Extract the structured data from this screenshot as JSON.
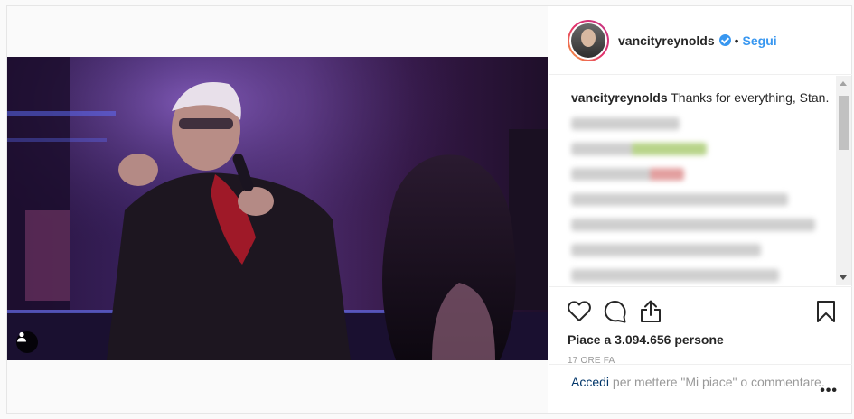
{
  "post": {
    "username": "vancityreynolds",
    "verified": true,
    "separator": "•",
    "follow_label": "Segui",
    "caption_user": "vancityreynolds",
    "caption_text": "Thanks for everything, Stan.",
    "likes": "Piace a 3.094.656 persone",
    "time": "17 ORE FA",
    "login_label": "Accedi",
    "login_suffix": "per mettere \"Mi piace\" o commentare.",
    "more_label": "•••"
  },
  "icons": {
    "like": "heart-icon",
    "comment": "comment-icon",
    "share": "share-icon",
    "save": "bookmark-icon",
    "tag": "user-tag-icon"
  },
  "colors": {
    "link": "#3897f0",
    "verified": "#3897f0",
    "login": "#003569",
    "muted": "#999999"
  }
}
